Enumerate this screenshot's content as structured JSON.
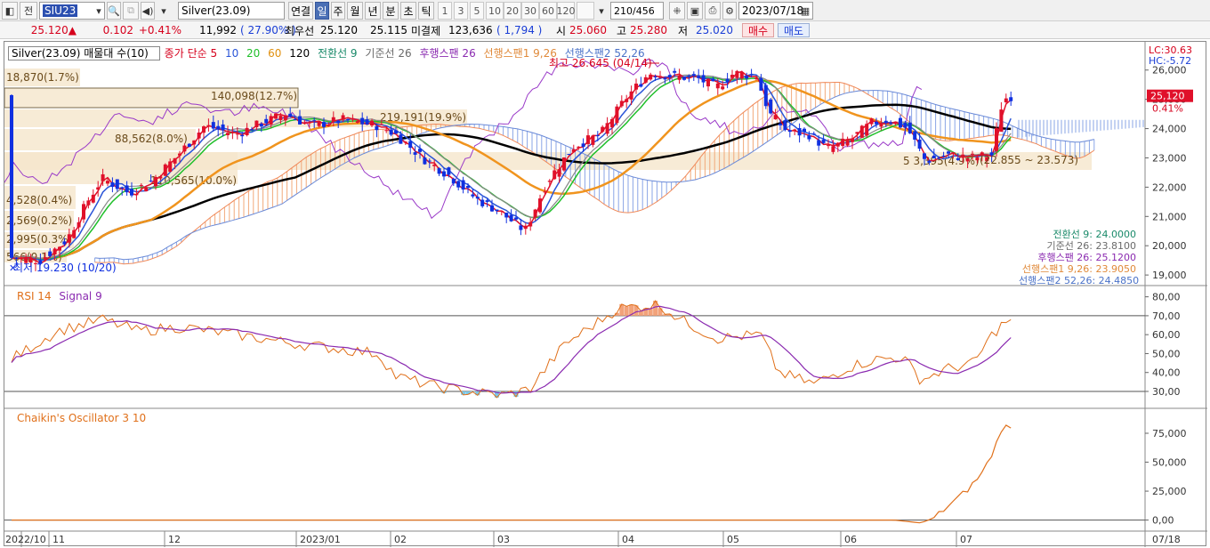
{
  "toolbar": {
    "mode_label": "전",
    "code_value": "SIU23",
    "name_value": "Silver(23.09)",
    "link_label": "연결",
    "periods": [
      "일",
      "주",
      "월",
      "년",
      "분",
      "초",
      "틱"
    ],
    "active_period": "일",
    "numbers": [
      "1",
      "3",
      "5",
      "10",
      "20",
      "30",
      "60",
      "120"
    ],
    "count_value": "210",
    "count_total": "/456",
    "date_value": "2023/07/18"
  },
  "quote": {
    "price": "25.120",
    "change": "0.102",
    "change_pct": "+0.41%",
    "volume": "11,992",
    "vol_ratio": "( 27.90% )",
    "best_label": "최우선",
    "best_bid": "25.120",
    "best_ask": "25.115",
    "oi_label": "미결제",
    "oi_value": "123,636",
    "oi_change": "( 1,794 )",
    "open_label": "시",
    "open_value": "25.060",
    "high_label": "고",
    "high_value": "25.280",
    "low_label": "저",
    "low_value": "25.020",
    "buy_label": "매수",
    "sell_label": "매도"
  },
  "legend_main": {
    "title": "Silver(23.09) 매물대 수(10)",
    "ma_label": "종가 단순 5",
    "ma10": "10",
    "ma20": "20",
    "ma60": "60",
    "ma120": "120",
    "tenkan": "전환선 9",
    "kijun": "기준선 26",
    "chikou": "후행스팬 26",
    "spanA": "선행스팬1 9,26",
    "spanB": "선행스팬2 52,26"
  },
  "corner": {
    "lc": "LC:30.63",
    "hc": "HC:-5.72"
  },
  "annotations": {
    "high_mark": "최고 26.645 (04/14)",
    "low_mark": "최저 19.230 (10/20)",
    "range_label": "(22.855 ~ 23.573)"
  },
  "volume_profile": [
    {
      "label": "18,870(1.7%)"
    },
    {
      "label": "140,098(12.7%)"
    },
    {
      "label": "219,191(19.9%)"
    },
    {
      "label": "88,562(8.0%)"
    },
    {
      "label": "110,565(10.0%)"
    },
    {
      "label": "4,528(0.4%)"
    },
    {
      "label": "2,569(0.2%)"
    },
    {
      "label": "2,995(0.3%)"
    },
    {
      "label": "566(0.1%)"
    },
    {
      "label": "5 3,395(4.9%)"
    }
  ],
  "ichimoku_values": [
    {
      "text": "전환선 9: 24.0000",
      "color": "#1a8a6a"
    },
    {
      "text": "기준선 26: 23.8100",
      "color": "#6a6a6a"
    },
    {
      "text": "후행스팬 26: 25.1200",
      "color": "#8a2ab0"
    },
    {
      "text": "선행스팬1 9,26: 23.9050",
      "color": "#e08a3a"
    },
    {
      "text": "선행스팬2 52,26: 24.4850",
      "color": "#4a72c8"
    }
  ],
  "price_axis": {
    "ticks": [
      "26,000",
      "25,000",
      "24,000",
      "23,000",
      "22,000",
      "21,000",
      "20,000",
      "19,000"
    ],
    "current": "25,120",
    "pct": "0.41%"
  },
  "rsi": {
    "title": "RSI 14",
    "signal": "Signal 9",
    "ticks": [
      "80,00",
      "70,00",
      "60,00",
      "50,00",
      "40,00",
      "30,00"
    ]
  },
  "chaikin": {
    "title": "Chaikin's Oscillator 3 10",
    "ticks": [
      "75,000",
      "50,000",
      "25,000",
      "0,00"
    ]
  },
  "time_axis": {
    "labels": [
      "2022/10",
      "11",
      "12",
      "2023/01",
      "02",
      "03",
      "04",
      "05",
      "06",
      "07"
    ],
    "right_label": "07/18"
  },
  "colors": {
    "up": "#e0102a",
    "down": "#1030e0",
    "ma5": "#e0102a",
    "ma10": "#2a55d8",
    "ma20": "#1fbf2a",
    "ma60": "#f0941e",
    "ma120": "#000000"
  },
  "chart_data": {
    "type": "line",
    "title": "Silver(23.09)",
    "x": [
      "2022/10",
      "11",
      "12",
      "2023/01",
      "02",
      "03",
      "04",
      "05",
      "06",
      "07",
      "07/18"
    ],
    "series": [
      {
        "name": "종가",
        "values": [
          19.3,
          20.8,
          22.9,
          24.0,
          23.6,
          20.5,
          24.9,
          25.8,
          23.6,
          22.9,
          25.12
        ]
      },
      {
        "name": "RSI 14",
        "values": [
          46,
          63,
          66,
          60,
          52,
          28,
          71,
          58,
          38,
          44,
          66
        ]
      },
      {
        "name": "Chaikin's Oscillator 3 10",
        "values": [
          0,
          0,
          0,
          0,
          0,
          0,
          0,
          0,
          0,
          30000,
          78000
        ]
      }
    ],
    "ylim": [
      18.7,
      26.6
    ]
  }
}
